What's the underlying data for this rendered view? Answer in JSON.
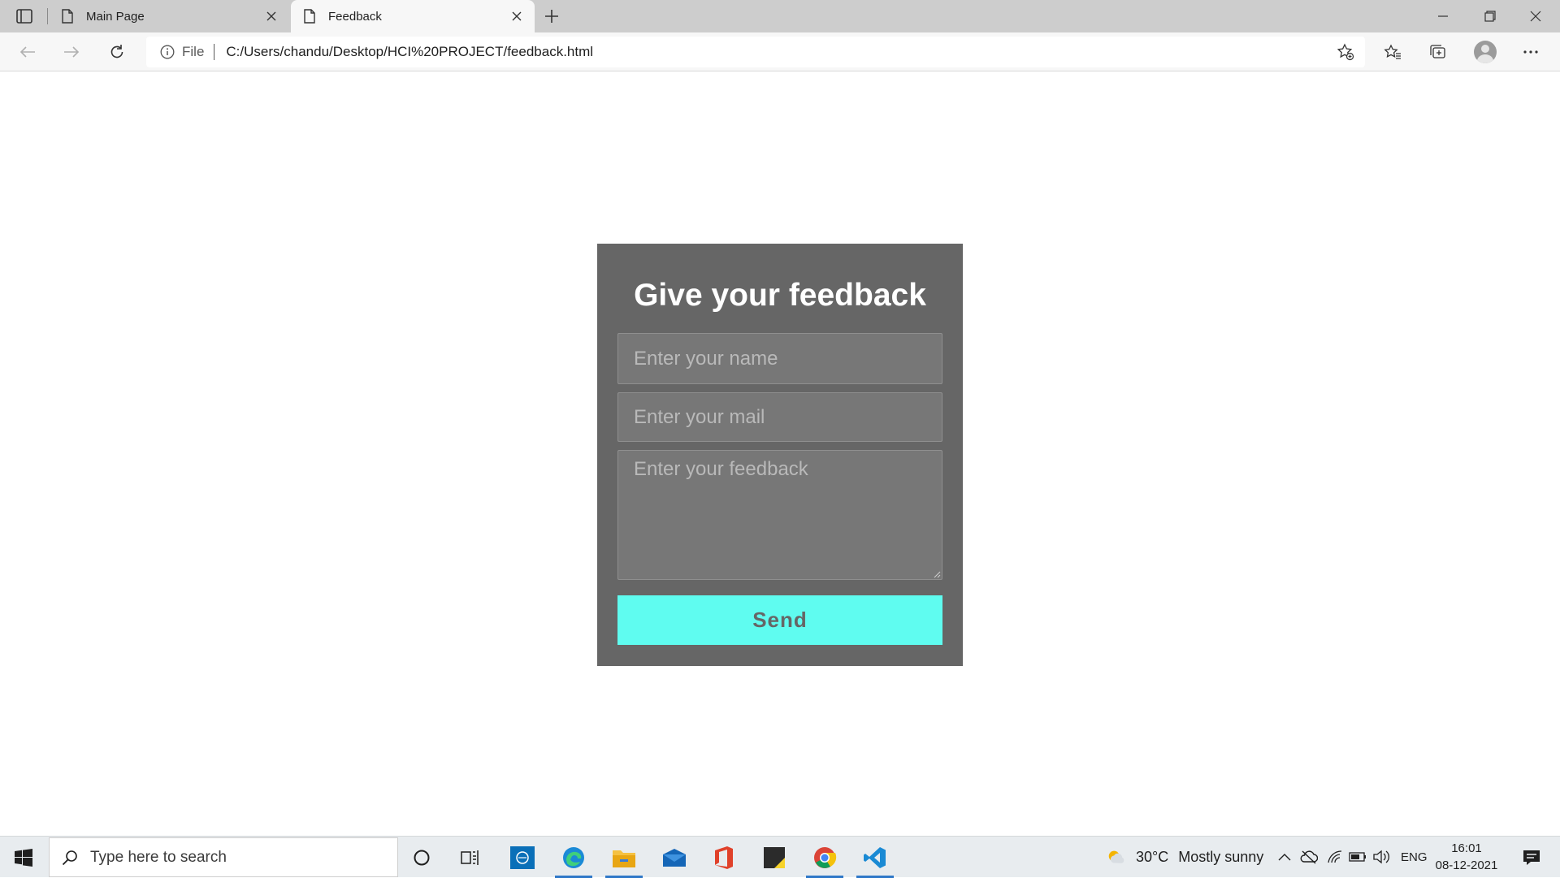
{
  "browser": {
    "tabs": [
      {
        "title": "Main Page",
        "active": false
      },
      {
        "title": "Feedback",
        "active": true
      }
    ],
    "address": {
      "scheme_label": "File",
      "url": "C:/Users/chandu/Desktop/HCI%20PROJECT/feedback.html"
    }
  },
  "form": {
    "title": "Give your feedback",
    "name_placeholder": "Enter your name",
    "mail_placeholder": "Enter your mail",
    "feedback_placeholder": "Enter your feedback",
    "name_value": "",
    "mail_value": "",
    "feedback_value": "",
    "send_label": "Send"
  },
  "taskbar": {
    "search_placeholder": "Type here to search",
    "weather": {
      "temp": "30°C",
      "condition": "Mostly sunny"
    },
    "language": "ENG",
    "time": "16:01",
    "date": "08-12-2021"
  },
  "colors": {
    "card_bg": "#666666",
    "field_bg": "#777777",
    "send_bg": "#5ffcf0",
    "send_text": "#666666"
  }
}
